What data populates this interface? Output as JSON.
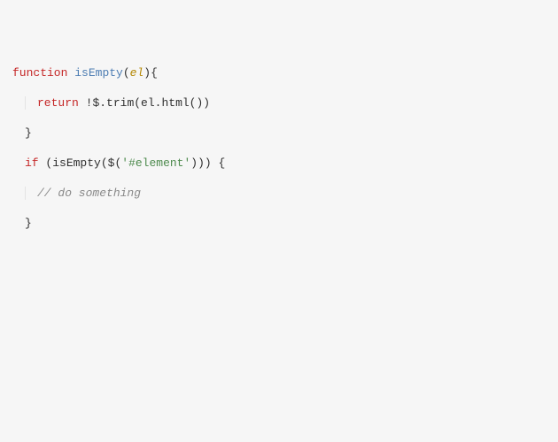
{
  "code": {
    "l1_kw_function": "function",
    "l1_fn_name": "isEmpty",
    "l1_paren_open": "(",
    "l1_param": "el",
    "l1_after_param": "){",
    "l2_kw_return": "return",
    "l2_sp": " ",
    "l2_bang": "!",
    "l2_dollar": "$",
    "l2_trim": ".trim(el.html())",
    "l3_brace": "}",
    "l4_kw_if": "if",
    "l4_sp": " ",
    "l4_open": "(isEmpty(",
    "l4_dollar": "$",
    "l4_open2": "(",
    "l4_str": "'#element'",
    "l4_close": "))) {",
    "l5_cmt": "// do something",
    "l6_brace": "}"
  }
}
